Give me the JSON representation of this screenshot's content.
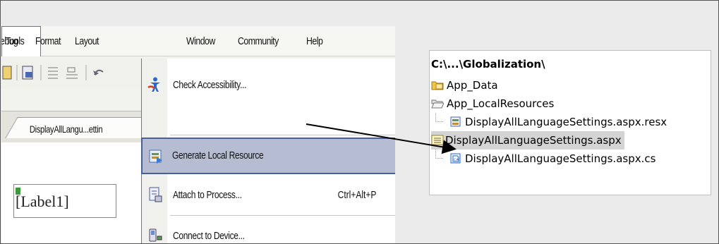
{
  "menubar": {
    "items": [
      "ebug",
      "Format",
      "Layout",
      "Tools",
      "Window",
      "Community",
      "Help"
    ],
    "active": "Tools"
  },
  "document_tab": {
    "label": "DisplayAllLangu...ettin"
  },
  "designer": {
    "label_control": "[Label1]"
  },
  "tools_menu": {
    "items": [
      {
        "label": "Check Accessibility...",
        "icon": "accessibility-icon",
        "shortcut": ""
      },
      {
        "label": "Generate Local Resource",
        "icon": "generate-resource-icon",
        "shortcut": "",
        "highlighted": true
      },
      {
        "label": "Attach to Process...",
        "icon": "attach-process-icon",
        "shortcut": "Ctrl+Alt+P"
      },
      {
        "label": "Connect to Device...",
        "icon": "connect-device-icon",
        "shortcut": ""
      }
    ]
  },
  "solution_explorer": {
    "root": "C:\\...\\Globalization\\",
    "items": [
      {
        "label": "App_Data",
        "icon": "folder-icon",
        "indent": 0
      },
      {
        "label": "App_LocalResources",
        "icon": "folder-open-icon",
        "indent": 0
      },
      {
        "label": "DisplayAllLanguageSettings.aspx.resx",
        "icon": "resx-file-icon",
        "indent": 1
      },
      {
        "label": "DisplayAllLanguageSettings.aspx",
        "icon": "aspx-file-icon",
        "indent": 0,
        "selected": true
      },
      {
        "label": "DisplayAllLanguageSettings.aspx.cs",
        "icon": "cs-file-icon",
        "indent": 1
      }
    ]
  },
  "colors": {
    "highlight_fill": "#b6bdd2",
    "highlight_border": "#4a5f9a",
    "folder": "#e8b93a"
  }
}
